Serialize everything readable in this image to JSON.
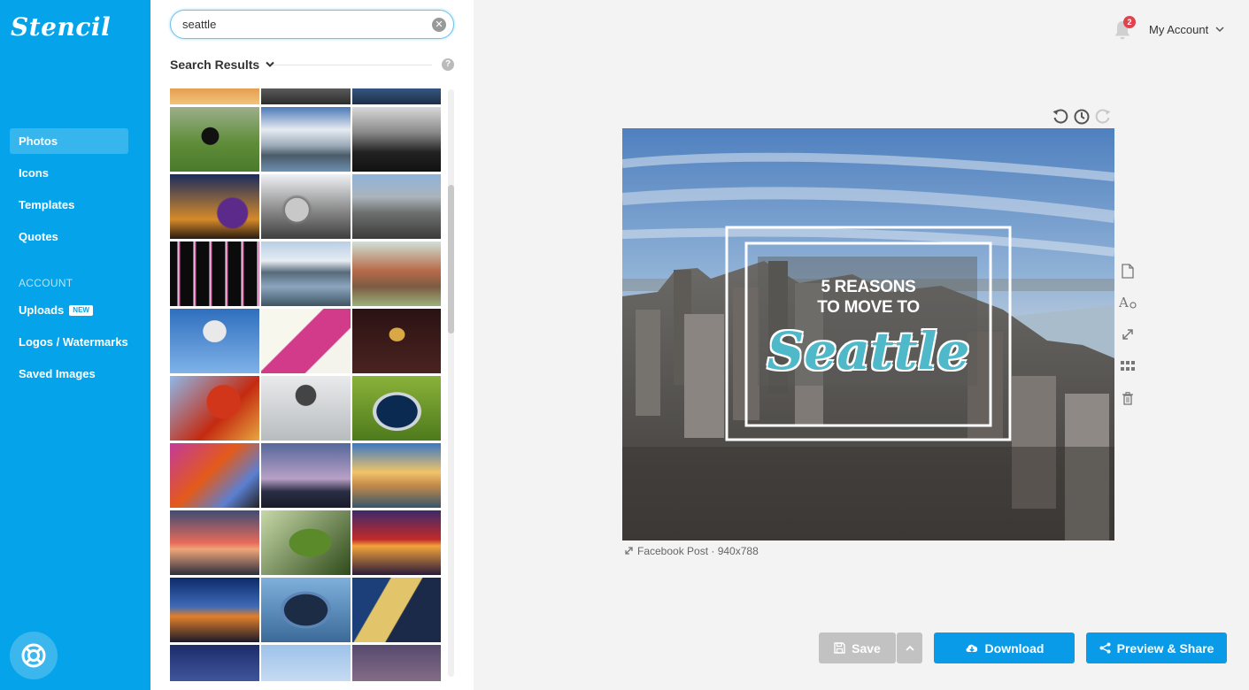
{
  "app": {
    "logo": "Stencil"
  },
  "nav": {
    "items": [
      {
        "label": "Photos",
        "active": true
      },
      {
        "label": "Icons"
      },
      {
        "label": "Templates"
      },
      {
        "label": "Quotes"
      }
    ],
    "account_section": "ACCOUNT",
    "account_items": [
      {
        "label": "Uploads",
        "badge": "NEW"
      },
      {
        "label": "Logos / Watermarks"
      },
      {
        "label": "Saved Images"
      }
    ],
    "help_icon": "lifebuoy-icon"
  },
  "search": {
    "value": "seattle",
    "results_label": "Search Results",
    "help_mark": "?"
  },
  "topbar": {
    "notifications_count": "2",
    "account_label": "My Account"
  },
  "canvas": {
    "headline_line1": "5 REASONS",
    "headline_line2": "TO MOVE TO",
    "script_word": "Seattle",
    "caption": "Facebook Post · 940x788"
  },
  "buttons": {
    "save": "Save",
    "download": "Download",
    "share": "Preview & Share"
  },
  "colors": {
    "brand": "#05a3e9",
    "primary_button": "#0a9be8",
    "disabled_button": "#c2c2c2",
    "script_text": "#4fb8c9",
    "notification": "#e0424e"
  },
  "thumbnails": [
    "sunset-strip",
    "pier-bw-strip",
    "skyline-strip",
    "crow-on-grass",
    "skyline-clouds",
    "industrial-bw",
    "night-skyline-dome",
    "metal-sphere",
    "aerial-city",
    "neon-lights",
    "lake-view",
    "gas-works",
    "space-needle-up",
    "car-wash-sign",
    "space-needle-night",
    "red-leaves",
    "space-needle-bw",
    "seahawks-ball",
    "emp-museum",
    "dusk-skyline",
    "harbor-sunset",
    "pink-sunset",
    "green-leaf",
    "public-market",
    "night-highway",
    "seahawks-football",
    "space-needle-gold",
    "blue-dusk",
    "cloudy-tower",
    "purple-sky"
  ]
}
